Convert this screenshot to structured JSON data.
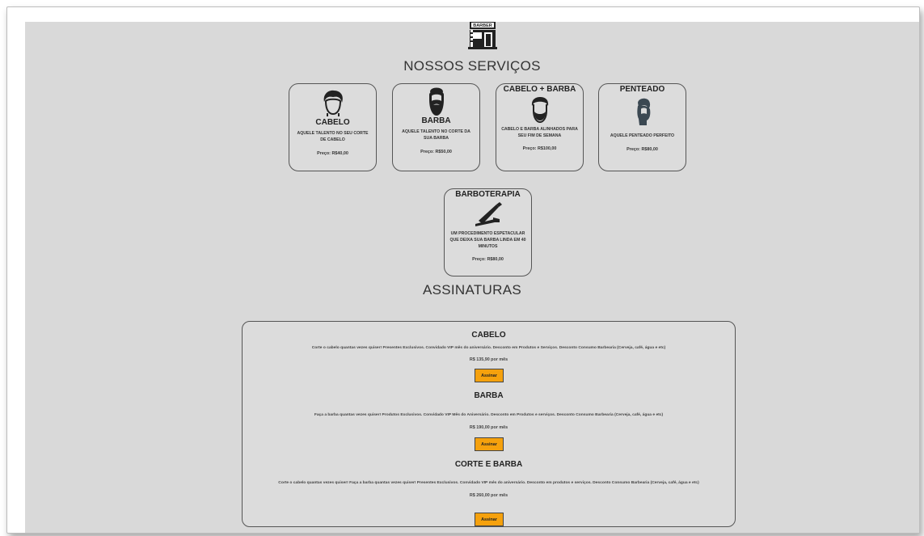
{
  "logo": {
    "text": "BARBER",
    "icon": "barber-shop-icon"
  },
  "services": {
    "title": "NOSSOS SERVIÇOS",
    "items": [
      {
        "title": "CABELO",
        "description": "AQUELE TALENTO NO SEU CORTE DE CABELO",
        "price": "Preço: R$40,00",
        "icon": "hair-icon"
      },
      {
        "title": "BARBA",
        "description": "AQUELE TALENTO NO CORTE DA SUA BARBA",
        "price": "Preço: R$50,00",
        "icon": "beard-icon"
      },
      {
        "title": "CABELO + BARBA",
        "description": "CABELO E BARBA ALINHADOS PARA SEU FIM DE SEMANA",
        "price": "Preço: R$100,00",
        "icon": "hair-beard-icon"
      },
      {
        "title": "PENTEADO",
        "description": "AQUELE PENTEADO PERFEITO",
        "price": "Preço: R$80,00",
        "icon": "hairstyle-icon"
      },
      {
        "title": "BARBOTERAPIA",
        "description": "UM PROCEDIMENTO ESPETACULAR QUE DEIXA SUA BARBA LINDA EM 40 MINUTOS",
        "price": "Preço: R$80,00",
        "icon": "razor-icon"
      }
    ]
  },
  "subscriptions": {
    "title": "ASSINATURAS",
    "plans": [
      {
        "title": "CABELO",
        "description": "Corte o cabelo quantas vezes quiser! Presentes Exclusivos. Convidado VIP mês do aniversário. Desconto em Produtos e Serviços. Desconto Consumo Barbearia (Cerveja, café, água e etc)",
        "price": "R$ 135,90 por mês",
        "button": "Assinar"
      },
      {
        "title": "BARBA",
        "description": "Faça a barba quantas vezes quiser! Produtos Exclusivos. Convidado VIP Mês do Aniversário. Desconto em Produtos e serviços. Desconto Consumo Barbearia (Cerveja, café, água e etc)",
        "price": "R$ 190,00 por mês",
        "button": "Assinar"
      },
      {
        "title": "CORTE E BARBA",
        "description": "Corte o cabelo quantas vezes quiser! Faça a barba quantas vezes quiser! Presentes Exclusivos. Convidado VIP mês do aniversário. Desconto em produtos e serviços. Desconto Consumo Barbearia (Cerveja, café, água e etc)",
        "price": "R$ 260,00 por mês",
        "button": "Assinar"
      }
    ]
  },
  "colors": {
    "background": "#d9d9d9",
    "button": "#f5a10d",
    "border": "#555555"
  }
}
